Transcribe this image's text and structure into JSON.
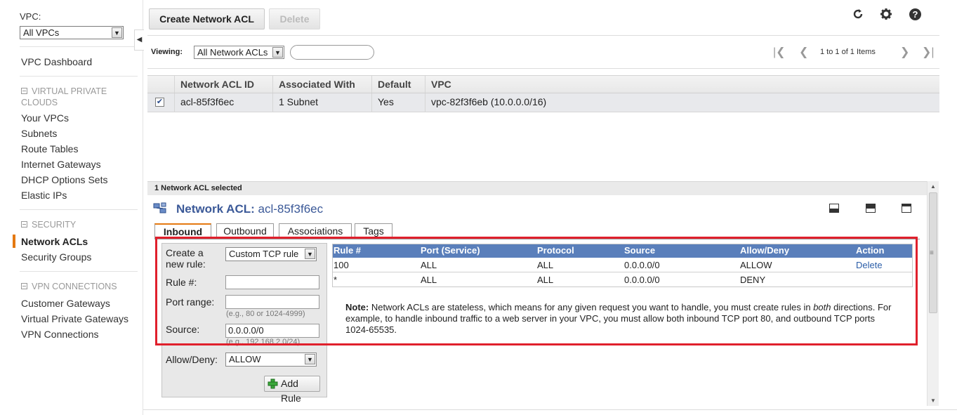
{
  "sidebar": {
    "vpc_label": "VPC:",
    "vpc_select": "All VPCs",
    "dashboard": "VPC Dashboard",
    "section_vpc": [
      "VIRTUAL PRIVATE",
      "CLOUDS"
    ],
    "vpc_items": [
      "Your VPCs",
      "Subnets",
      "Route Tables",
      "Internet Gateways",
      "DHCP Options Sets",
      "Elastic IPs"
    ],
    "section_security": "SECURITY",
    "security_items": [
      "Network ACLs",
      "Security Groups"
    ],
    "section_vpn": "VPN CONNECTIONS",
    "vpn_items": [
      "Customer Gateways",
      "Virtual Private Gateways",
      "VPN Connections"
    ]
  },
  "toolbar": {
    "create_label": "Create Network ACL",
    "delete_label": "Delete"
  },
  "filter": {
    "viewing_label": "Viewing:",
    "view_select": "All Network ACLs",
    "search_value": "",
    "pager_text": "1 to 1 of 1 Items"
  },
  "grid": {
    "columns": [
      "Network ACL ID",
      "Associated With",
      "Default",
      "VPC"
    ],
    "rows": [
      {
        "checked": true,
        "id": "acl-85f3f6ec",
        "associated": "1 Subnet",
        "default": "Yes",
        "vpc": "vpc-82f3f6eb (10.0.0.0/16)"
      }
    ]
  },
  "detail": {
    "selected_text": "1 Network ACL selected",
    "title_prefix": "Network ACL:",
    "title_value": "acl-85f3f6ec",
    "tabs": [
      "Inbound",
      "Outbound",
      "Associations",
      "Tags"
    ],
    "active_tab": "Inbound"
  },
  "form": {
    "create_label_1": "Create a",
    "create_label_2": "new rule:",
    "rule_type": "Custom TCP rule",
    "rule_num_label": "Rule #:",
    "rule_num_value": "",
    "port_label": "Port range:",
    "port_value": "",
    "port_hint": "(e.g., 80 or 1024-4999)",
    "source_label": "Source:",
    "source_value": "0.0.0.0/0",
    "source_hint": "(e.g., 192.168.2.0/24)",
    "allow_label": "Allow/Deny:",
    "allow_value": "ALLOW",
    "add_label": "Add Rule"
  },
  "rules": {
    "columns": [
      "Rule #",
      "Port (Service)",
      "Protocol",
      "Source",
      "Allow/Deny",
      "Action"
    ],
    "rows": [
      {
        "rule": "100",
        "port": "ALL",
        "protocol": "ALL",
        "source": "0.0.0.0/0",
        "allow": "ALLOW",
        "action": "Delete"
      },
      {
        "rule": "*",
        "port": "ALL",
        "protocol": "ALL",
        "source": "0.0.0.0/0",
        "allow": "DENY",
        "action": ""
      }
    ],
    "note_bold": "Note:",
    "note_1": " Network ACLs are stateless, which means for any given request you want to handle, you must create rules in ",
    "note_italic": "both",
    "note_2": " directions. For example, to handle inbound traffic to a web server in your VPC, you must allow both inbound TCP port 80, and outbound TCP ports 1024-65535."
  },
  "colors": {
    "accent": "#e47911",
    "rules_header": "#5a7fbb",
    "highlight_box": "#e0202c",
    "link": "#2b5ea8"
  }
}
